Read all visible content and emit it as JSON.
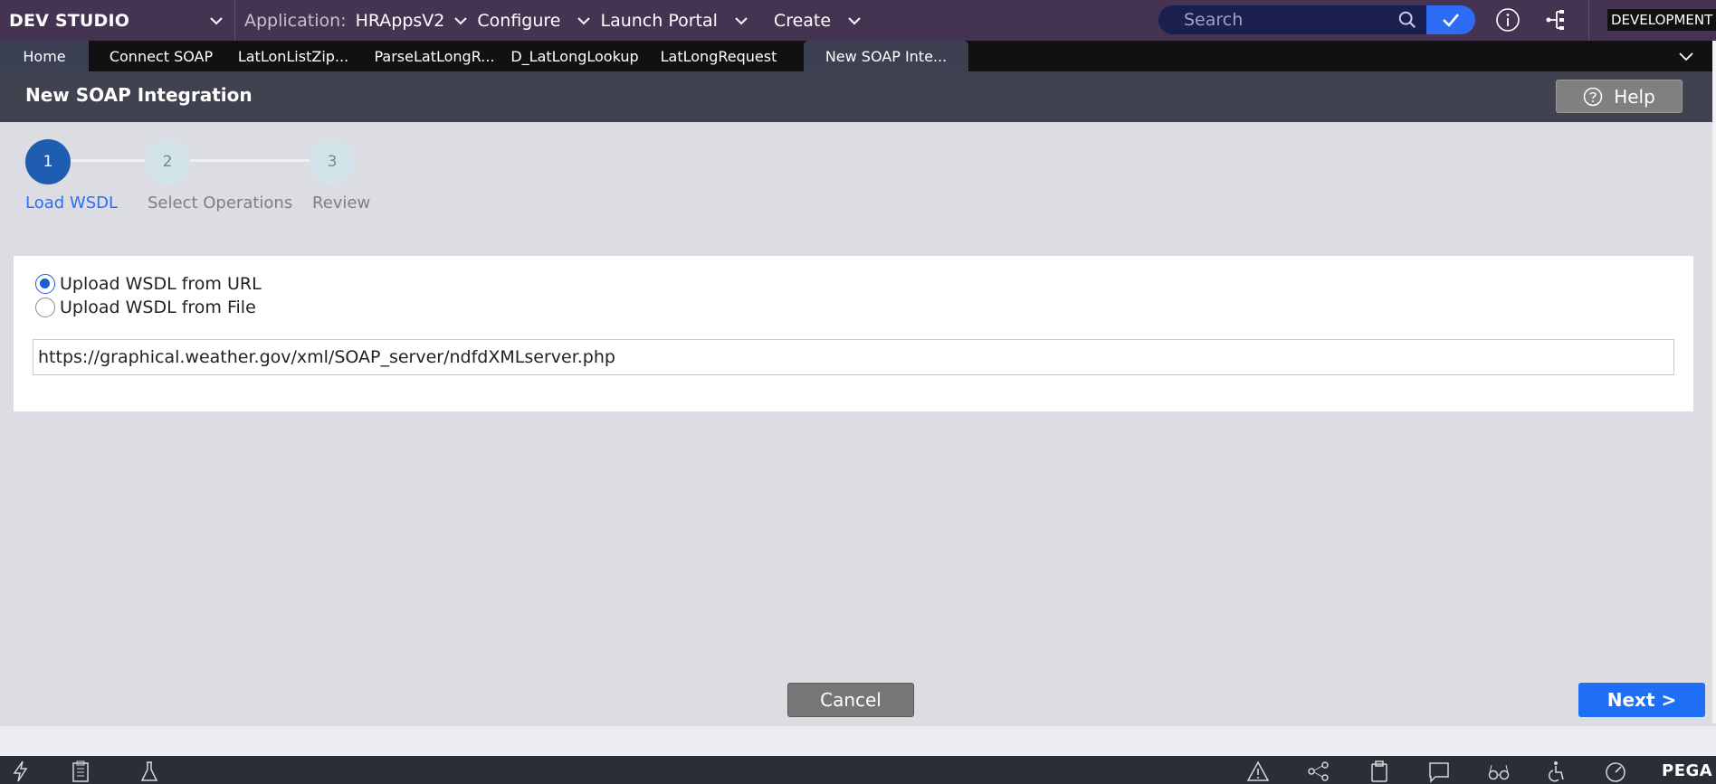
{
  "topbar": {
    "brand": "DEV STUDIO",
    "app_prefix": "Application:",
    "app_name": "HRAppsV2",
    "menu": [
      "Configure",
      "Launch Portal",
      "Create"
    ],
    "search_placeholder": "Search",
    "environment": "DEVELOPMENT",
    "icons": [
      "chevron-down-icon",
      "search-icon",
      "check-icon",
      "info-icon",
      "hierarchy-icon"
    ],
    "accent_color": "#2f6cf6"
  },
  "tabs": [
    {
      "label": "Home"
    },
    {
      "label": "Connect SOAP"
    },
    {
      "label": "LatLonListZip..."
    },
    {
      "label": "ParseLatLongR..."
    },
    {
      "label": "D_LatLongLookup"
    },
    {
      "label": "LatLongRequest"
    },
    {
      "label": "New SOAP Inte..."
    }
  ],
  "page": {
    "title": "New SOAP Integration",
    "help_label": "Help"
  },
  "stepper": {
    "current_step": 1,
    "steps": [
      {
        "number": "1",
        "label": "Load WSDL"
      },
      {
        "number": "2",
        "label": "Select Operations"
      },
      {
        "number": "3",
        "label": "Review"
      }
    ]
  },
  "form": {
    "options": [
      {
        "label": "Upload WSDL from URL",
        "selected": true
      },
      {
        "label": "Upload WSDL from File",
        "selected": false
      }
    ],
    "url_value": "https://graphical.weather.gov/xml/SOAP_server/ndfdXMLserver.php"
  },
  "footer": {
    "cancel_label": "Cancel",
    "next_label": "Next >"
  },
  "bottombar": {
    "icons": [
      "lightning-icon",
      "clipboard-list-icon",
      "flask-icon",
      "warning-icon",
      "share-nodes-icon",
      "clipboard-icon",
      "chat-icon",
      "glasses-icon",
      "accessibility-icon",
      "gauge-icon"
    ],
    "logo": "PEGA"
  }
}
